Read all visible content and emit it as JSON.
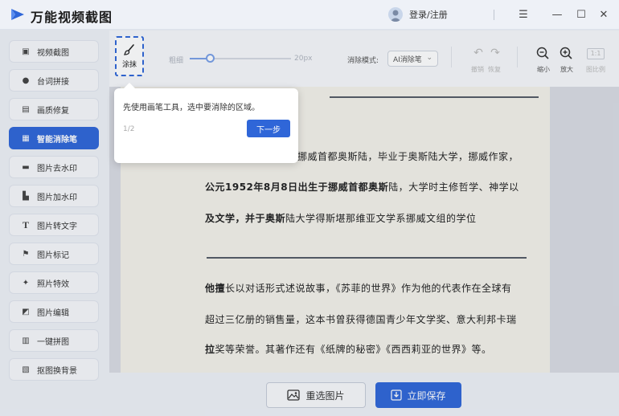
{
  "app": {
    "title": "万能视频截图",
    "login": "登录/注册",
    "brand_color": "#2f66d8"
  },
  "window_controls": {
    "menu": "☰",
    "minimize": "—",
    "maximize": "☐",
    "close": "✕"
  },
  "sidebar": {
    "items": [
      {
        "label": "视频截图",
        "icon": "video-icon"
      },
      {
        "label": "台词拼接",
        "icon": "subtitle-icon"
      },
      {
        "label": "画质修复",
        "icon": "image-repair-icon"
      },
      {
        "label": "智能消除笔",
        "icon": "eraser-icon",
        "active": true
      },
      {
        "label": "图片去水印",
        "icon": "watermark-remove-icon"
      },
      {
        "label": "图片加水印",
        "icon": "watermark-add-icon"
      },
      {
        "label": "图片转文字",
        "icon": "text-icon"
      },
      {
        "label": "图片标记",
        "icon": "flag-icon"
      },
      {
        "label": "照片特效",
        "icon": "effects-icon"
      },
      {
        "label": "图片编辑",
        "icon": "edit-icon"
      },
      {
        "label": "一键拼图",
        "icon": "collage-icon"
      },
      {
        "label": "抠图换背景",
        "icon": "cutout-icon"
      }
    ]
  },
  "toolbar": {
    "brush_label": "涂抹",
    "thickness_label": "粗细",
    "thickness_value": "20px",
    "thickness_fraction": 0.2,
    "mode_label": "消除模式:",
    "mode_value": "AI消除笔",
    "undo_label": "撤销",
    "redo_label": "恢复",
    "zoom_out_label": "缩小",
    "zoom_in_label": "放大",
    "ratio_value": "1:1",
    "ratio_label": "图比例"
  },
  "document": {
    "line1": "挪威首都奥斯陆，毕业于奥斯陆大学，挪威作家，",
    "line2_bold": "公元1952年8月8日出生于挪威首都奥斯",
    "line2_rest": "陆，大学时主修哲学、神学以",
    "line3_bold": "及文学，并于奥斯",
    "line3_rest": "陆大学得斯堪那维亚文学系挪威文组的学位",
    "line4_bold": "他擅",
    "line4_rest": "长以对话形式述说故事，《苏菲的世界》作为他的代表作在全球有",
    "line5": "超过三亿册的销售量，这本书曾获得德国青少年文学奖、意大利邦卡瑞",
    "line6_bold": "拉",
    "line6_rest": "奖等荣誉。其著作还有《纸牌的秘密》《西西莉亚的世界》等。"
  },
  "tooltip": {
    "text": "先使用画笔工具，选中要消除的区域。",
    "step": "1/2",
    "next": "下一步"
  },
  "bottom": {
    "reselect": "重选图片",
    "save": "立即保存"
  }
}
